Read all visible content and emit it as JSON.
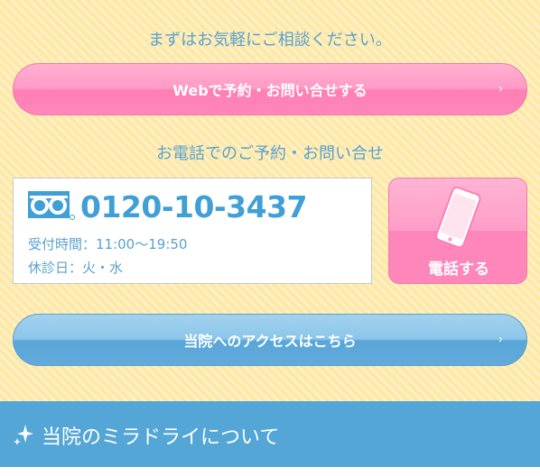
{
  "intro": {
    "text": "まずはお気軽にご相談ください。"
  },
  "web_button": {
    "label": "Webで予約・お問い合せする",
    "chevron": "›"
  },
  "tel_section": {
    "heading": "お電話でのご予約・お問い合せ"
  },
  "tel_box": {
    "icon": "freedial-icon",
    "number": "0120-10-3437",
    "hours": "受付時間：11:00〜19:50",
    "holiday": "休診日：火・水"
  },
  "call_button": {
    "label": "電話する",
    "icon": "smartphone-icon"
  },
  "access_button": {
    "label": "当院へのアクセスはこちら",
    "chevron": "›"
  },
  "section": {
    "title": "当院のミラドライについて",
    "icon": "sparkle-icon"
  },
  "colors": {
    "panel_bg": "#fde8a6",
    "pink": "#ff86ba",
    "blue": "#54a6d6",
    "text_blue": "#5aa1cf"
  }
}
